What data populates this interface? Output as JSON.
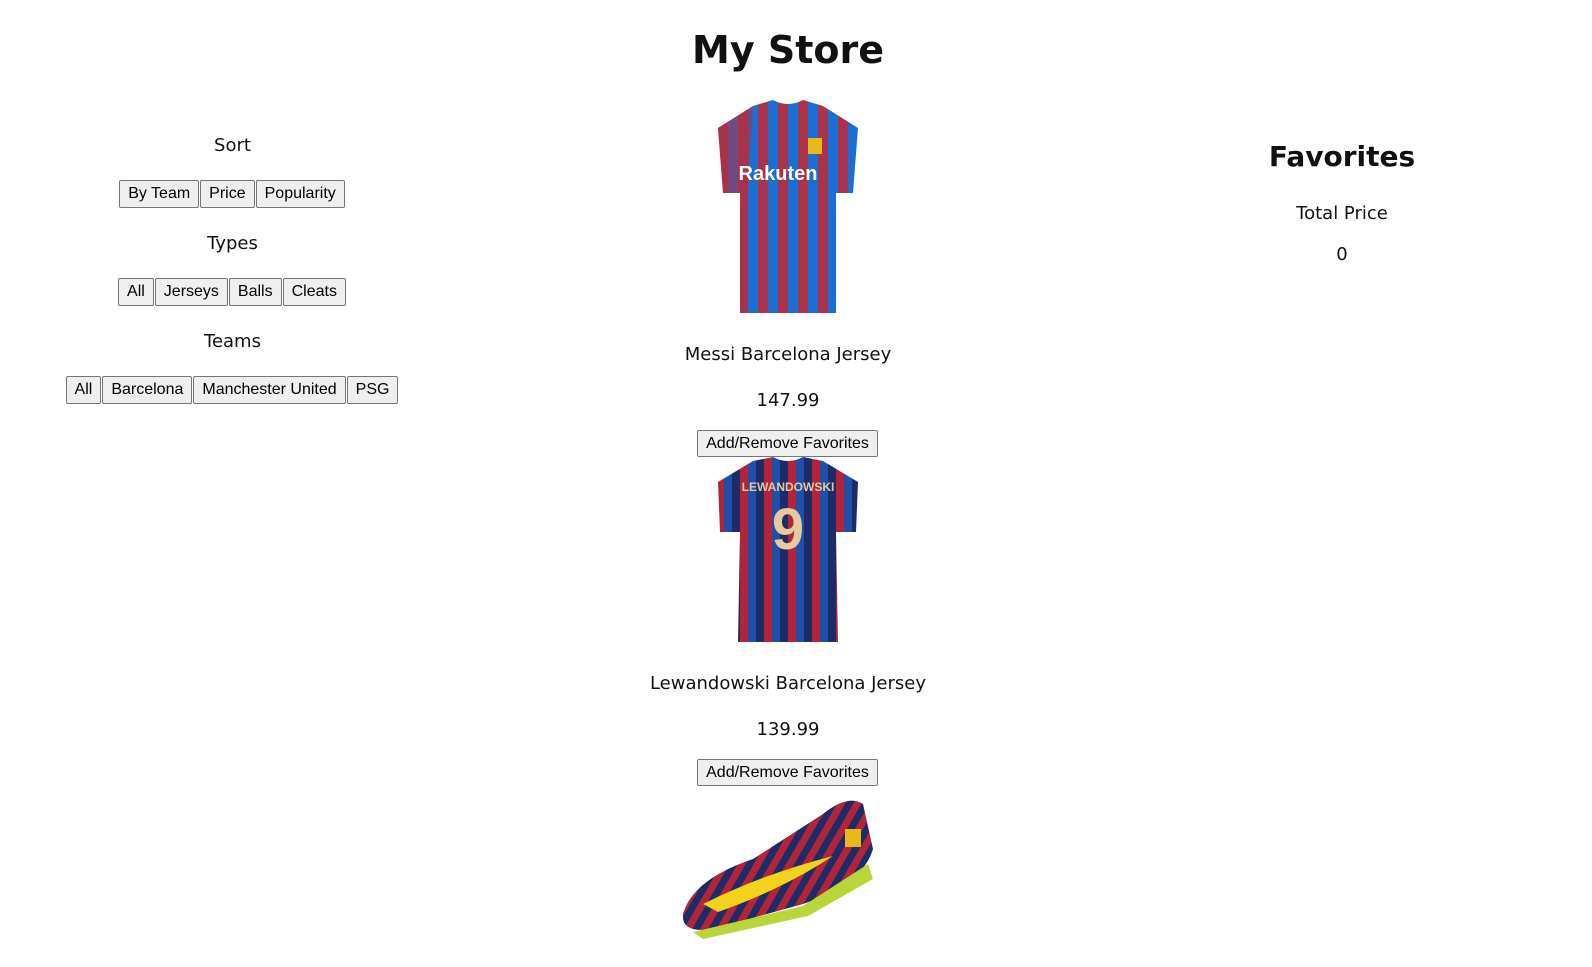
{
  "title": "My Store",
  "sort": {
    "label": "Sort",
    "buttons": [
      "By Team",
      "Price",
      "Popularity"
    ]
  },
  "types": {
    "label": "Types",
    "buttons": [
      "All",
      "Jerseys",
      "Balls",
      "Cleats"
    ]
  },
  "teams": {
    "label": "Teams",
    "buttons": [
      "All",
      "Barcelona",
      "Manchester United",
      "PSG"
    ]
  },
  "products": [
    {
      "name": "Messi Barcelona Jersey",
      "price": "147.99",
      "button": "Add/Remove Favorites",
      "sponsor": "Rakuten"
    },
    {
      "name": "Lewandowski Barcelona Jersey",
      "price": "139.99",
      "button": "Add/Remove Favorites",
      "player_print": "LEWANDOWSKI",
      "number": "9"
    },
    {}
  ],
  "favorites": {
    "title": "Favorites",
    "total_label": "Total Price",
    "total_value": "0"
  }
}
